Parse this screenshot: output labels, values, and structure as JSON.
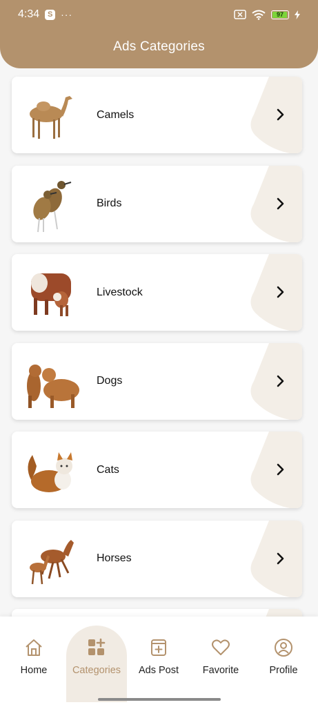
{
  "status_bar": {
    "time": "4:34",
    "app_icon_letter": "S",
    "more_dots": "···",
    "battery_percent": "97"
  },
  "header": {
    "title": "Ads Categories"
  },
  "categories": [
    {
      "label": "Camels",
      "icon": "camel-image"
    },
    {
      "label": "Birds",
      "icon": "birds-image"
    },
    {
      "label": "Livestock",
      "icon": "livestock-image"
    },
    {
      "label": "Dogs",
      "icon": "dogs-image"
    },
    {
      "label": "Cats",
      "icon": "cat-image"
    },
    {
      "label": "Horses",
      "icon": "horses-image"
    }
  ],
  "bottom_nav": {
    "items": [
      {
        "label": "Home",
        "icon": "home-icon",
        "active": false
      },
      {
        "label": "Categories",
        "icon": "categories-icon",
        "active": true
      },
      {
        "label": "Ads Post",
        "icon": "ads-post-icon",
        "active": false
      },
      {
        "label": "Favorite",
        "icon": "heart-icon",
        "active": false
      },
      {
        "label": "Profile",
        "icon": "profile-icon",
        "active": false
      }
    ]
  },
  "colors": {
    "brand": "#b3926d",
    "active_nav_bg": "#f1ebe3",
    "card_deco": "#f3eee7",
    "battery_green": "#7cd43a"
  }
}
